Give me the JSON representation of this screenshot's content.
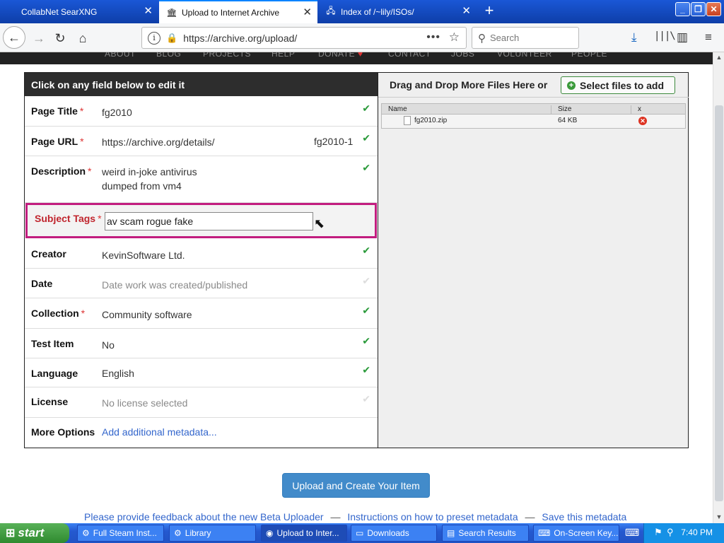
{
  "browser": {
    "tabs": [
      {
        "label": "CollabNet SearXNG"
      },
      {
        "label": "Upload to Internet Archive"
      },
      {
        "label": "Index of /~lily/ISOs/"
      }
    ],
    "url": "https://archive.org/upload/",
    "search_placeholder": "Search"
  },
  "site_nav": [
    "ABOUT",
    "BLOG",
    "PROJECTS",
    "HELP",
    "DONATE",
    "CONTACT",
    "JOBS",
    "VOLUNTEER",
    "PEOPLE"
  ],
  "form": {
    "header": "Click on any field below to edit it",
    "fields": [
      {
        "label": "Page Title",
        "required": "*",
        "value": "fg2010"
      },
      {
        "label": "Page URL",
        "required": "*",
        "value": "https://archive.org/details/",
        "suffix": "fg2010-1"
      },
      {
        "label": "Description",
        "required": "*",
        "value_line1": "weird in-joke antivirus",
        "value_line2": "dumped from vm4"
      },
      {
        "label": "Subject Tags",
        "required": "*",
        "value": "av scam rogue fake"
      },
      {
        "label": "Creator",
        "value": "KevinSoftware Ltd."
      },
      {
        "label": "Date",
        "value": "Date work was created/published"
      },
      {
        "label": "Collection",
        "required": "*",
        "value": "Community software"
      },
      {
        "label": "Test Item",
        "value": "No"
      },
      {
        "label": "Language",
        "value": "English"
      },
      {
        "label": "License",
        "value": "No license selected"
      },
      {
        "label": "More Options",
        "value": "Add additional metadata..."
      }
    ]
  },
  "files": {
    "heading": "Drag and Drop More Files Here or",
    "select_button": "Select files to add",
    "columns": [
      "Name",
      "Size",
      "x"
    ],
    "rows": [
      {
        "name": "fg2010.zip",
        "size": "64 KB"
      }
    ]
  },
  "upload_button": "Upload and Create Your Item",
  "footer": {
    "link1": "Please provide feedback about the new Beta Uploader",
    "link2": "Instructions on how to preset metadata",
    "link3": "Save this metadata",
    "sep": "—"
  },
  "taskbar": {
    "start": "start",
    "tasks": [
      "Full Steam Inst...",
      "Library",
      "Upload to Inter...",
      "Downloads",
      "Search Results",
      "On-Screen Key..."
    ],
    "clock": "7:40 PM"
  }
}
